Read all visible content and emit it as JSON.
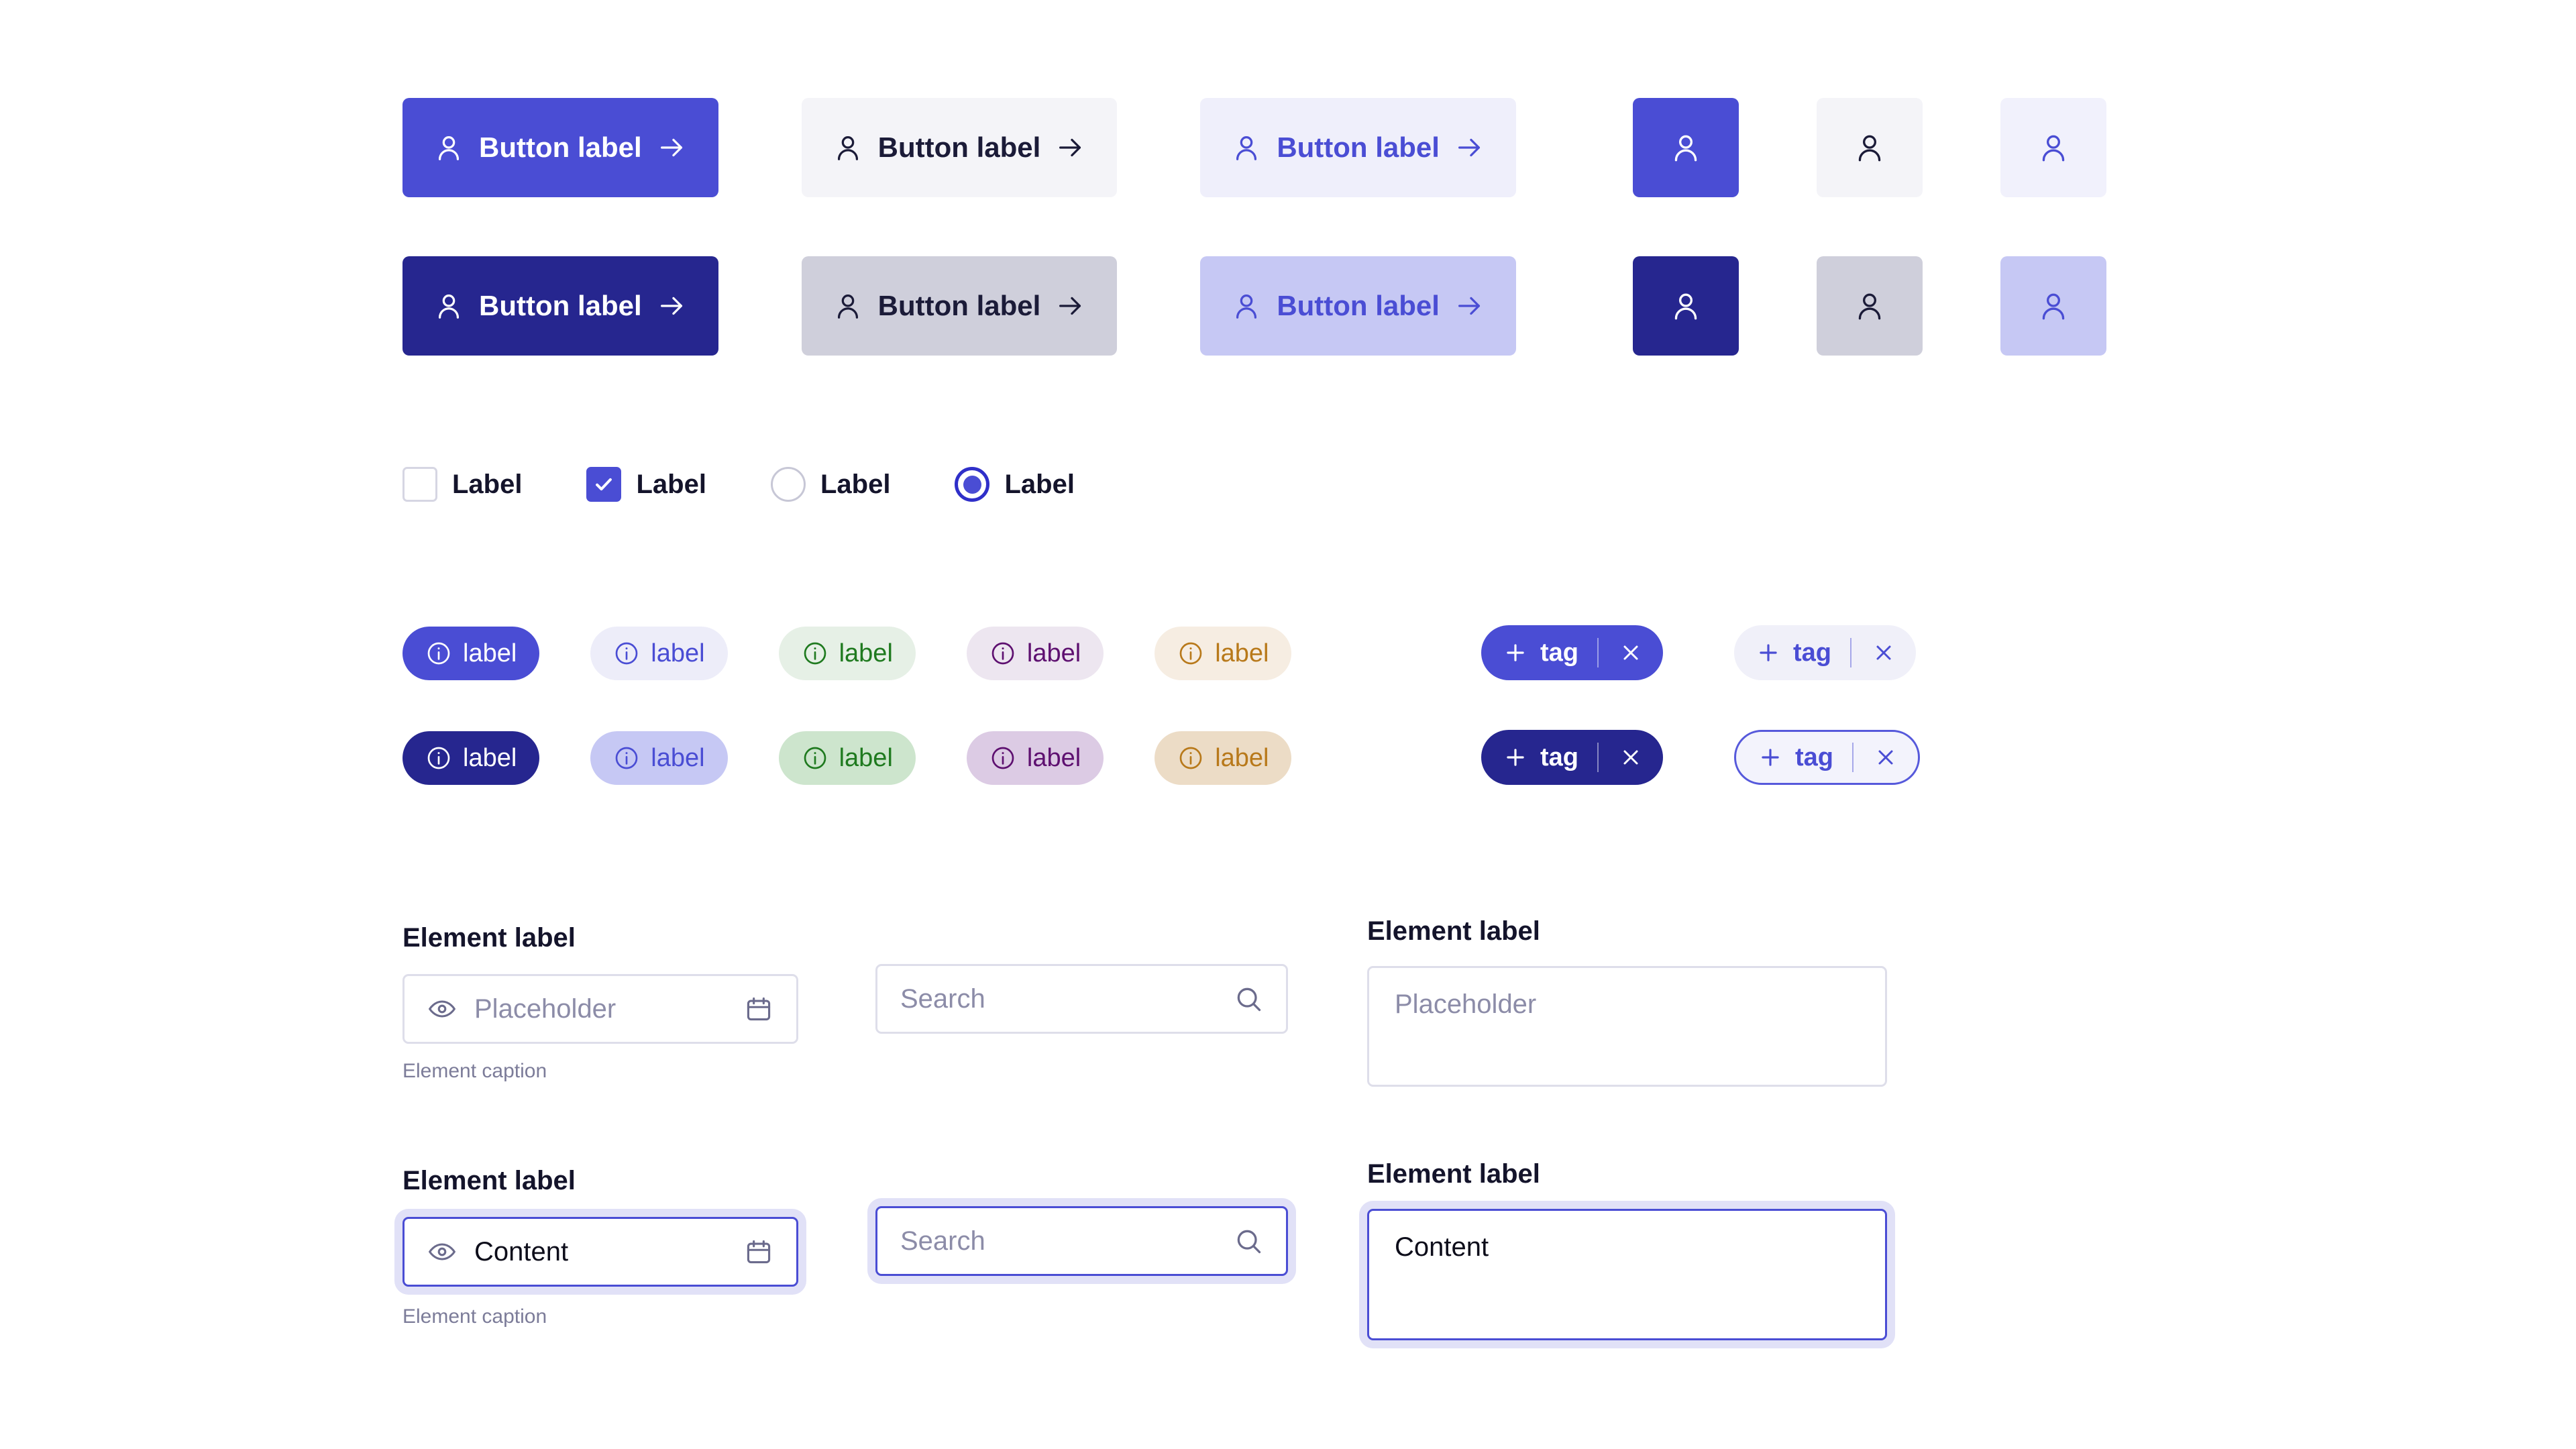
{
  "theme": {
    "accent": "#4A4DD4",
    "accent_dark": "#26268F",
    "accent_soft": "#EFEFFB",
    "neutral_soft": "#F4F4F8",
    "neutral_press": "#CFCFDB",
    "text_dark": "#14142B",
    "text_muted": "#7C7C99",
    "border": "#DEDEEA",
    "focus_ring": "#E1E1F7",
    "green": "#1F7A1F",
    "purple": "#5E1070",
    "amber": "#B8791A"
  },
  "buttons": {
    "label": "Button label",
    "row_default": [
      {
        "label": "Button label",
        "variant": "primary",
        "leading_icon": "user-icon",
        "trailing_icon": "arrow-right-icon"
      },
      {
        "label": "Button label",
        "variant": "secondary",
        "leading_icon": "user-icon",
        "trailing_icon": "arrow-right-icon"
      },
      {
        "label": "Button label",
        "variant": "tertiary",
        "leading_icon": "user-icon",
        "trailing_icon": "arrow-right-icon"
      }
    ],
    "row_pressed": [
      {
        "label": "Button label",
        "variant": "primary-pressed",
        "leading_icon": "user-icon",
        "trailing_icon": "arrow-right-icon"
      },
      {
        "label": "Button label",
        "variant": "secondary-pressed",
        "leading_icon": "user-icon",
        "trailing_icon": "arrow-right-icon"
      },
      {
        "label": "Button label",
        "variant": "tertiary-pressed",
        "leading_icon": "user-icon",
        "trailing_icon": "arrow-right-icon"
      }
    ],
    "icon_only": {
      "icon": "user-icon"
    }
  },
  "choices": [
    {
      "type": "checkbox",
      "checked": false,
      "label": "Label"
    },
    {
      "type": "checkbox",
      "checked": true,
      "label": "Label"
    },
    {
      "type": "radio",
      "checked": false,
      "label": "Label"
    },
    {
      "type": "radio",
      "checked": true,
      "label": "Label"
    }
  ],
  "badges": {
    "label": "label",
    "icon": "info-icon",
    "row_default": [
      {
        "label": "label",
        "tone": "indigo-solid"
      },
      {
        "label": "label",
        "tone": "indigo-soft"
      },
      {
        "label": "label",
        "tone": "green-soft"
      },
      {
        "label": "label",
        "tone": "purple-soft"
      },
      {
        "label": "label",
        "tone": "amber-soft"
      }
    ],
    "row_strong": [
      {
        "label": "label",
        "tone": "indigo-dark"
      },
      {
        "label": "label",
        "tone": "indigo-soft-strong"
      },
      {
        "label": "label",
        "tone": "green-soft-strong"
      },
      {
        "label": "label",
        "tone": "purple-soft-strong"
      },
      {
        "label": "label",
        "tone": "amber-soft-strong"
      }
    ]
  },
  "tags": {
    "label": "tag",
    "add_icon": "plus-icon",
    "close_icon": "close-icon",
    "row_default": [
      {
        "label": "tag",
        "tone": "indigo-solid"
      },
      {
        "label": "tag",
        "tone": "indigo-soft"
      }
    ],
    "row_strong": [
      {
        "label": "tag",
        "tone": "indigo-dark"
      },
      {
        "label": "tag",
        "tone": "outline"
      }
    ]
  },
  "fields": {
    "date_default": {
      "label": "Element label",
      "placeholder": "Placeholder",
      "caption": "Element caption",
      "leading_icon": "eye-icon",
      "trailing_icon": "calendar-icon"
    },
    "date_focused": {
      "label": "Element label",
      "value": "Content",
      "caption": "Element caption",
      "leading_icon": "eye-icon",
      "trailing_icon": "calendar-icon"
    },
    "search_default": {
      "placeholder": "Search",
      "trailing_icon": "search-icon"
    },
    "search_focused": {
      "placeholder": "Search",
      "trailing_icon": "search-icon"
    },
    "textarea_default": {
      "label": "Element label",
      "placeholder": "Placeholder"
    },
    "textarea_focused": {
      "label": "Element label",
      "value": "Content"
    }
  }
}
